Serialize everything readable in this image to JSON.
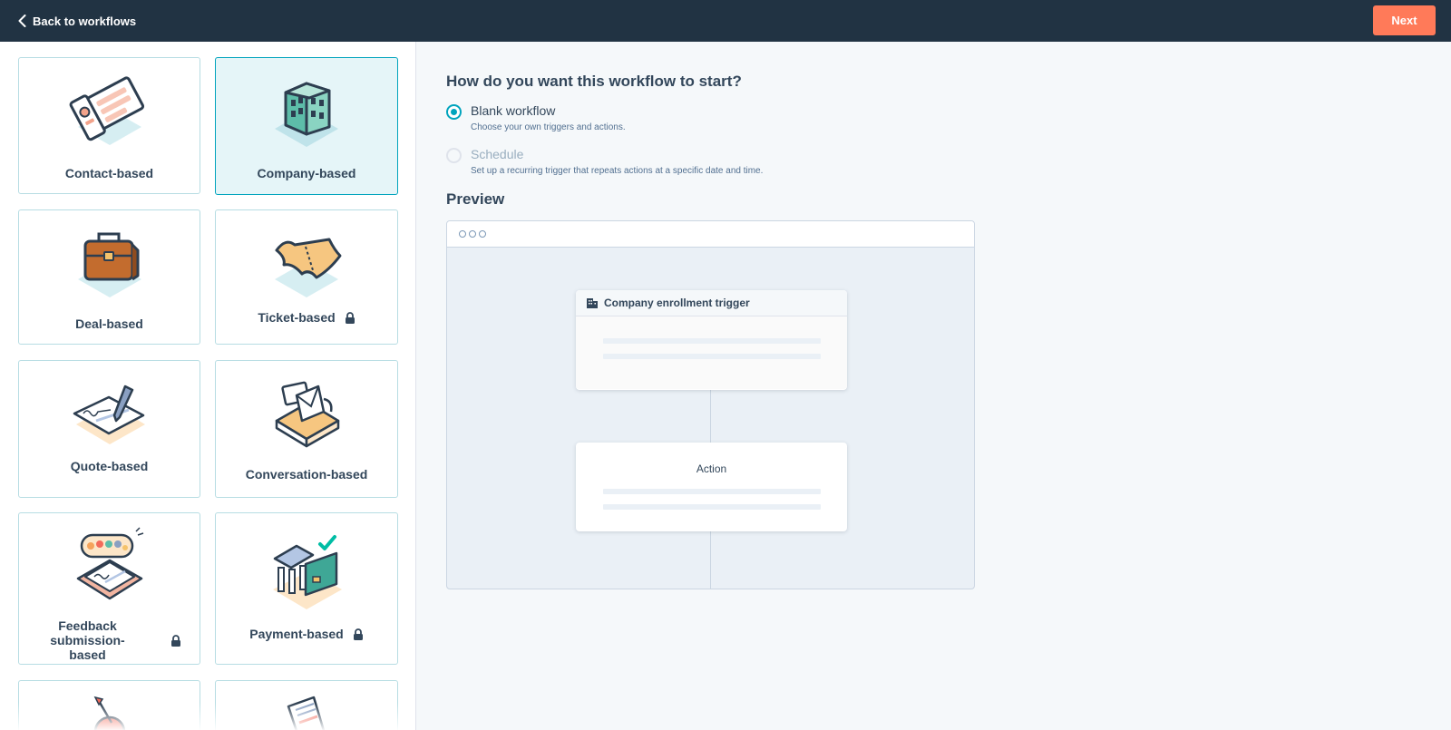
{
  "topbar": {
    "back_label": "Back to workflows",
    "next_label": "Next",
    "background_color": "#213343",
    "next_color": "#ff7a59"
  },
  "cards": [
    {
      "label": "Contact-based",
      "icon": "contact-card-icon",
      "selected": false,
      "locked": false
    },
    {
      "label": "Company-based",
      "icon": "building-icon",
      "selected": true,
      "locked": false
    },
    {
      "label": "Deal-based",
      "icon": "briefcase-icon",
      "selected": false,
      "locked": false
    },
    {
      "label": "Ticket-based",
      "icon": "ticket-icon",
      "selected": false,
      "locked": true
    },
    {
      "label": "Quote-based",
      "icon": "signed-quote-icon",
      "selected": false,
      "locked": false
    },
    {
      "label": "Conversation-based",
      "icon": "inbox-envelope-icon",
      "selected": false,
      "locked": false
    },
    {
      "label": "Feedback submission-based",
      "icon": "feedback-clipboard-icon",
      "selected": false,
      "locked": true
    },
    {
      "label": "Payment-based",
      "icon": "bank-card-icon",
      "selected": false,
      "locked": true
    }
  ],
  "start": {
    "question": "How do you want this workflow to start?",
    "options": [
      {
        "title": "Blank workflow",
        "description": "Choose your own triggers and actions.",
        "selected": true,
        "enabled": true
      },
      {
        "title": "Schedule",
        "description": "Set up a recurring trigger that repeats actions at a specific date and time.",
        "selected": false,
        "enabled": false
      }
    ]
  },
  "preview": {
    "title": "Preview",
    "trigger_label": "Company enrollment trigger",
    "action_label": "Action"
  },
  "colors": {
    "accent": "#00a4bd",
    "selected_card_bg": "#e5f5f8",
    "text": "#33475b"
  }
}
